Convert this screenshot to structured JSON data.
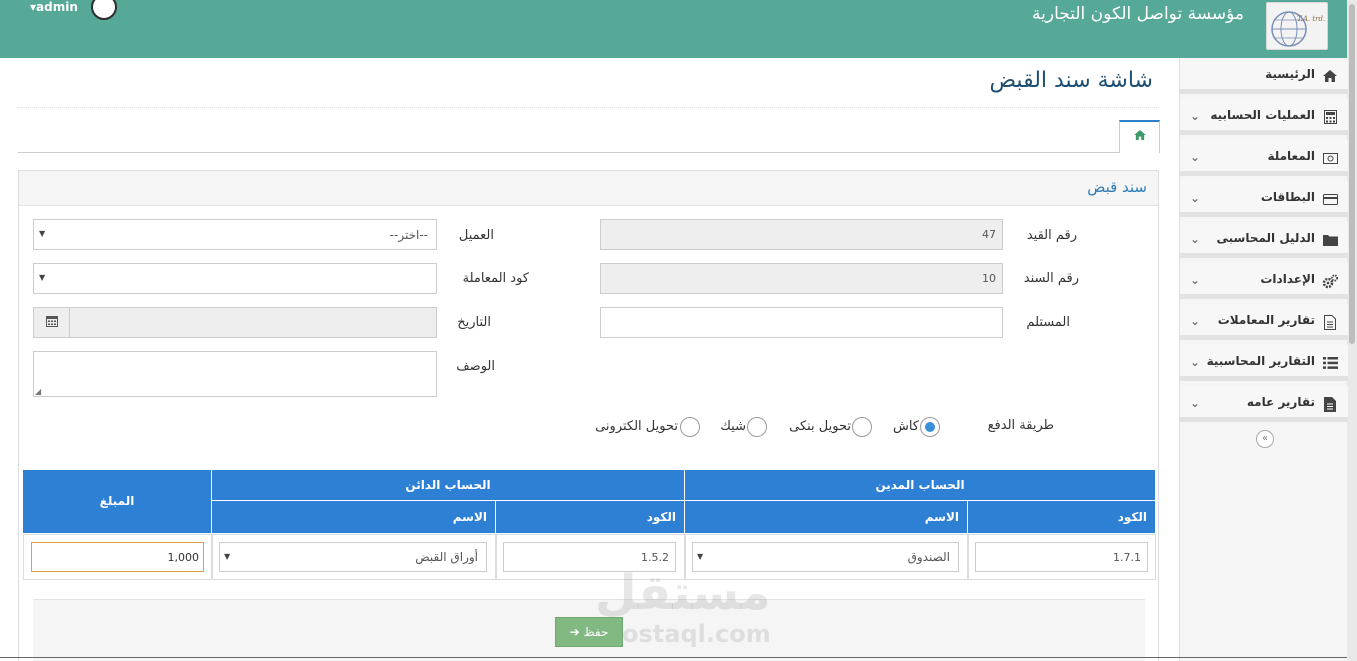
{
  "header": {
    "company_name": "مؤسسة تواصل الكون التجارية",
    "user_name": "admin",
    "logo_text": "T.A. trd. srv."
  },
  "sidebar": {
    "items": [
      {
        "label": "الرئيسية",
        "icon": "home-icon",
        "has_children": false
      },
      {
        "label": "العمليات الحسابيه",
        "icon": "calculator-icon",
        "has_children": true
      },
      {
        "label": "المعاملة",
        "icon": "money-icon",
        "has_children": true
      },
      {
        "label": "البطاقات",
        "icon": "credit-card-icon",
        "has_children": true
      },
      {
        "label": "الدليل المحاسبى",
        "icon": "folder-icon",
        "has_children": true
      },
      {
        "label": "الإعدادات",
        "icon": "gears-icon",
        "has_children": true
      },
      {
        "label": "تقارير المعاملات",
        "icon": "file-text-icon",
        "has_children": true
      },
      {
        "label": "التقارير المحاسبية",
        "icon": "list-icon",
        "has_children": true
      },
      {
        "label": "تقارير عامه",
        "icon": "file-icon",
        "has_children": true
      }
    ]
  },
  "page": {
    "title": "شاشة سند القبض",
    "panel_title": "سند قبض"
  },
  "form": {
    "entry_no_label": "رقم القيد",
    "entry_no_value": "47",
    "voucher_no_label": "رقم السند",
    "voucher_no_value": "10",
    "receiver_label": "المستلم",
    "receiver_value": "",
    "customer_label": "العميل",
    "customer_value": "--اختر--",
    "transaction_code_label": "كود المعاملة",
    "transaction_code_value": "",
    "date_label": "التاريخ",
    "date_value": "",
    "description_label": "الوصف",
    "description_value": "",
    "payment_method_label": "طريقة الدفع",
    "payment_methods": [
      "كاش",
      "تحويل بنكى",
      "شيك",
      "تحويل الكترونى"
    ],
    "selected_payment": "كاش"
  },
  "table": {
    "debit_header": "الحساب المدين",
    "credit_header": "الحساب الدائن",
    "amount_header": "المبلغ",
    "code_header": "الكود",
    "name_header": "الاسم",
    "row": {
      "debit_code": "1.7.1",
      "debit_name": "الصندوق",
      "credit_code": "1.5.2",
      "credit_name": "أوراق القبض",
      "amount": "1,000"
    }
  },
  "actions": {
    "save_label": "حفظ"
  },
  "watermark": {
    "text_ar": "مستقل",
    "text_en": "mostaql.com"
  },
  "colors": {
    "header_bg": "#56a897",
    "table_header_bg": "#2d80d3",
    "title_color": "#1e4f72",
    "save_button_bg": "#82b982"
  }
}
